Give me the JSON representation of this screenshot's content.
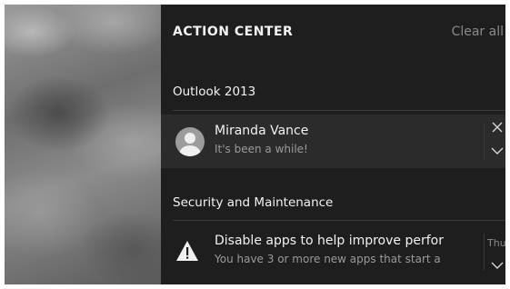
{
  "action_center": {
    "title": "ACTION CENTER",
    "clear_all": "Clear all"
  },
  "groups": [
    {
      "app": "Outlook 2013",
      "notification": {
        "title": "Miranda Vance",
        "body": "It's been a while!",
        "icon": "avatar-icon"
      }
    },
    {
      "app": "Security and Maintenance",
      "notification": {
        "title": "Disable apps to help improve perfor",
        "body": "You have 3 or more new apps that start a",
        "time": "Thu",
        "icon": "warning-icon"
      }
    }
  ],
  "colors": {
    "panel_bg": "#1e1e1e",
    "highlight_bg": "#2b2b2b",
    "secondary_text": "#9a9a9a"
  }
}
